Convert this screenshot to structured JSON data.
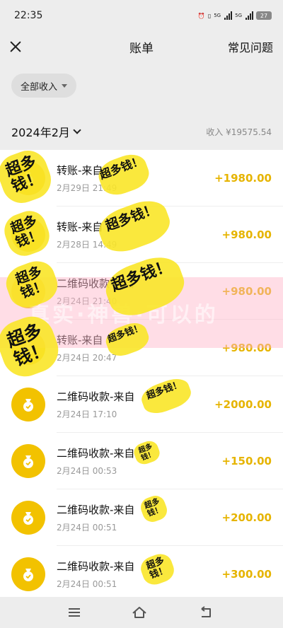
{
  "status": {
    "time": "22:35",
    "net1": "5G",
    "net2": "5G",
    "battery": "27"
  },
  "nav": {
    "title": "账单",
    "faq": "常见问题"
  },
  "filter": {
    "label": "全部收入"
  },
  "month": {
    "label": "2024年2月",
    "total": "收入 ¥19575.54"
  },
  "items": [
    {
      "title": "转账-来自",
      "time": "2月29日 21:49",
      "amount": "+1980.00"
    },
    {
      "title": "转账-来自",
      "time": "2月28日 14:49",
      "amount": "+980.00"
    },
    {
      "title": "二维码收款-来自",
      "time": "2月24日 21:40",
      "amount": "+980.00"
    },
    {
      "title": "转账-来自",
      "time": "2月24日 20:47",
      "amount": "+980.00"
    },
    {
      "title": "二维码收款-来自",
      "time": "2月24日 17:10",
      "amount": "+2000.00"
    },
    {
      "title": "二维码收款-来自",
      "time": "2月24日 00:53",
      "amount": "+150.00"
    },
    {
      "title": "二维码收款-来自",
      "time": "2月24日 00:51",
      "amount": "+200.00"
    },
    {
      "title": "二维码收款-来自",
      "time": "2月24日 00:51",
      "amount": "+300.00"
    }
  ],
  "stickers": {
    "text": "超多钱！"
  },
  "banner": {
    "text": "真实·神兽·可以的"
  },
  "colors": {
    "accent": "#e6b400",
    "avatar": "#f2c200"
  }
}
